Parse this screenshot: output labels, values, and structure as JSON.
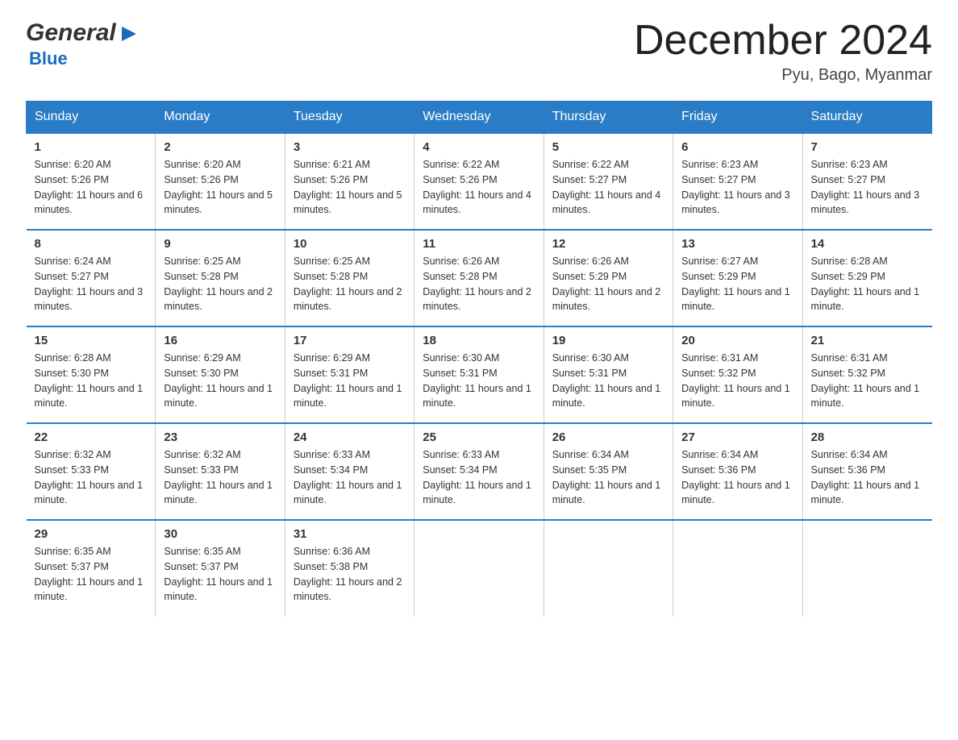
{
  "header": {
    "logo_general": "General",
    "logo_blue": "Blue",
    "month_title": "December 2024",
    "location": "Pyu, Bago, Myanmar"
  },
  "days_of_week": [
    "Sunday",
    "Monday",
    "Tuesday",
    "Wednesday",
    "Thursday",
    "Friday",
    "Saturday"
  ],
  "weeks": [
    [
      {
        "day": "1",
        "sunrise": "6:20 AM",
        "sunset": "5:26 PM",
        "daylight": "11 hours and 6 minutes."
      },
      {
        "day": "2",
        "sunrise": "6:20 AM",
        "sunset": "5:26 PM",
        "daylight": "11 hours and 5 minutes."
      },
      {
        "day": "3",
        "sunrise": "6:21 AM",
        "sunset": "5:26 PM",
        "daylight": "11 hours and 5 minutes."
      },
      {
        "day": "4",
        "sunrise": "6:22 AM",
        "sunset": "5:26 PM",
        "daylight": "11 hours and 4 minutes."
      },
      {
        "day": "5",
        "sunrise": "6:22 AM",
        "sunset": "5:27 PM",
        "daylight": "11 hours and 4 minutes."
      },
      {
        "day": "6",
        "sunrise": "6:23 AM",
        "sunset": "5:27 PM",
        "daylight": "11 hours and 3 minutes."
      },
      {
        "day": "7",
        "sunrise": "6:23 AM",
        "sunset": "5:27 PM",
        "daylight": "11 hours and 3 minutes."
      }
    ],
    [
      {
        "day": "8",
        "sunrise": "6:24 AM",
        "sunset": "5:27 PM",
        "daylight": "11 hours and 3 minutes."
      },
      {
        "day": "9",
        "sunrise": "6:25 AM",
        "sunset": "5:28 PM",
        "daylight": "11 hours and 2 minutes."
      },
      {
        "day": "10",
        "sunrise": "6:25 AM",
        "sunset": "5:28 PM",
        "daylight": "11 hours and 2 minutes."
      },
      {
        "day": "11",
        "sunrise": "6:26 AM",
        "sunset": "5:28 PM",
        "daylight": "11 hours and 2 minutes."
      },
      {
        "day": "12",
        "sunrise": "6:26 AM",
        "sunset": "5:29 PM",
        "daylight": "11 hours and 2 minutes."
      },
      {
        "day": "13",
        "sunrise": "6:27 AM",
        "sunset": "5:29 PM",
        "daylight": "11 hours and 1 minute."
      },
      {
        "day": "14",
        "sunrise": "6:28 AM",
        "sunset": "5:29 PM",
        "daylight": "11 hours and 1 minute."
      }
    ],
    [
      {
        "day": "15",
        "sunrise": "6:28 AM",
        "sunset": "5:30 PM",
        "daylight": "11 hours and 1 minute."
      },
      {
        "day": "16",
        "sunrise": "6:29 AM",
        "sunset": "5:30 PM",
        "daylight": "11 hours and 1 minute."
      },
      {
        "day": "17",
        "sunrise": "6:29 AM",
        "sunset": "5:31 PM",
        "daylight": "11 hours and 1 minute."
      },
      {
        "day": "18",
        "sunrise": "6:30 AM",
        "sunset": "5:31 PM",
        "daylight": "11 hours and 1 minute."
      },
      {
        "day": "19",
        "sunrise": "6:30 AM",
        "sunset": "5:31 PM",
        "daylight": "11 hours and 1 minute."
      },
      {
        "day": "20",
        "sunrise": "6:31 AM",
        "sunset": "5:32 PM",
        "daylight": "11 hours and 1 minute."
      },
      {
        "day": "21",
        "sunrise": "6:31 AM",
        "sunset": "5:32 PM",
        "daylight": "11 hours and 1 minute."
      }
    ],
    [
      {
        "day": "22",
        "sunrise": "6:32 AM",
        "sunset": "5:33 PM",
        "daylight": "11 hours and 1 minute."
      },
      {
        "day": "23",
        "sunrise": "6:32 AM",
        "sunset": "5:33 PM",
        "daylight": "11 hours and 1 minute."
      },
      {
        "day": "24",
        "sunrise": "6:33 AM",
        "sunset": "5:34 PM",
        "daylight": "11 hours and 1 minute."
      },
      {
        "day": "25",
        "sunrise": "6:33 AM",
        "sunset": "5:34 PM",
        "daylight": "11 hours and 1 minute."
      },
      {
        "day": "26",
        "sunrise": "6:34 AM",
        "sunset": "5:35 PM",
        "daylight": "11 hours and 1 minute."
      },
      {
        "day": "27",
        "sunrise": "6:34 AM",
        "sunset": "5:36 PM",
        "daylight": "11 hours and 1 minute."
      },
      {
        "day": "28",
        "sunrise": "6:34 AM",
        "sunset": "5:36 PM",
        "daylight": "11 hours and 1 minute."
      }
    ],
    [
      {
        "day": "29",
        "sunrise": "6:35 AM",
        "sunset": "5:37 PM",
        "daylight": "11 hours and 1 minute."
      },
      {
        "day": "30",
        "sunrise": "6:35 AM",
        "sunset": "5:37 PM",
        "daylight": "11 hours and 1 minute."
      },
      {
        "day": "31",
        "sunrise": "6:36 AM",
        "sunset": "5:38 PM",
        "daylight": "11 hours and 2 minutes."
      },
      null,
      null,
      null,
      null
    ]
  ],
  "labels": {
    "sunrise": "Sunrise:",
    "sunset": "Sunset:",
    "daylight": "Daylight:"
  }
}
